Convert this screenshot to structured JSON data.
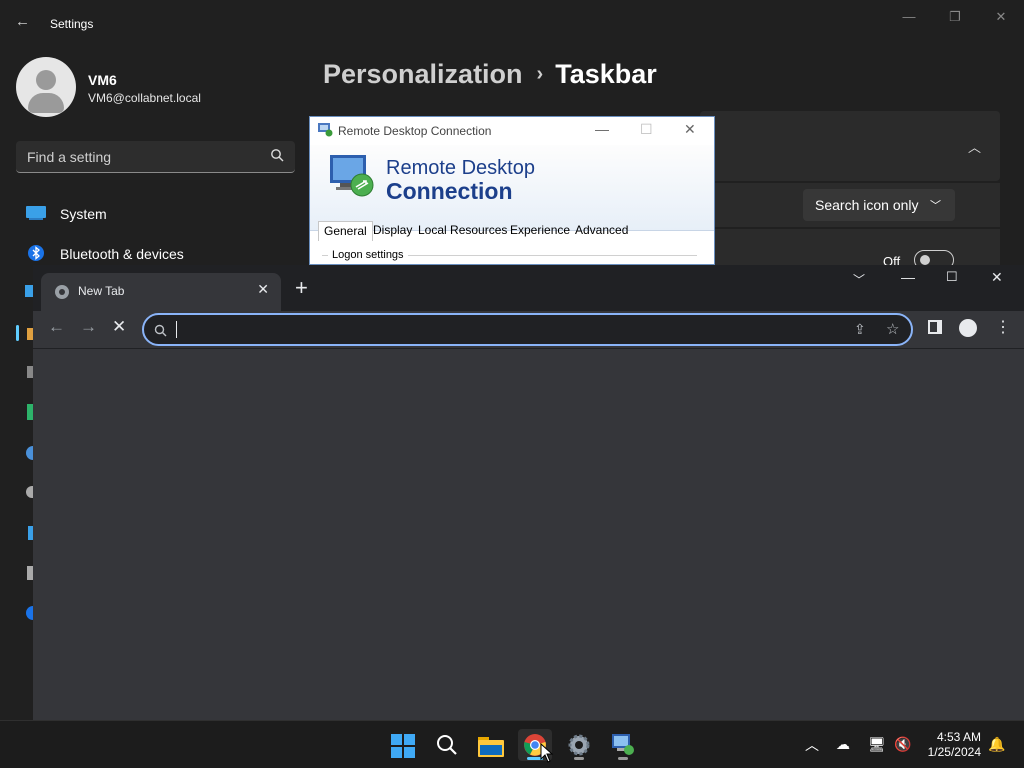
{
  "settings": {
    "window_title": "Settings",
    "user": {
      "name": "VM6",
      "email": "VM6@collabnet.local"
    },
    "find_placeholder": "Find a setting",
    "nav_items": [
      {
        "label": "System",
        "icon": "monitor-icon"
      },
      {
        "label": "Bluetooth & devices",
        "icon": "bluetooth-icon"
      }
    ],
    "breadcrumb": {
      "parent": "Personalization",
      "separator": "›",
      "current": "Taskbar"
    },
    "search_dropdown_value": "Search icon only",
    "toggle_label": "Off"
  },
  "rdc": {
    "window_title": "Remote Desktop Connection",
    "banner_line1": "Remote Desktop",
    "banner_line2": "Connection",
    "tabs": [
      "General",
      "Display",
      "Local Resources",
      "Experience",
      "Advanced"
    ],
    "selected_tab": "General",
    "group_label": "Logon settings"
  },
  "chrome": {
    "tab_title": "New Tab",
    "omnibox_value": ""
  },
  "taskbar": {
    "apps": [
      "start-icon",
      "search-icon",
      "file-explorer-icon",
      "chrome-icon",
      "settings-icon",
      "remote-desktop-icon"
    ],
    "active_app": "chrome-icon",
    "time": "4:53 AM",
    "date": "1/25/2024"
  },
  "colors": {
    "accent": "#60cdff",
    "chrome_focus": "#8ab4f8",
    "rdc_title": "#1c3f8b"
  }
}
